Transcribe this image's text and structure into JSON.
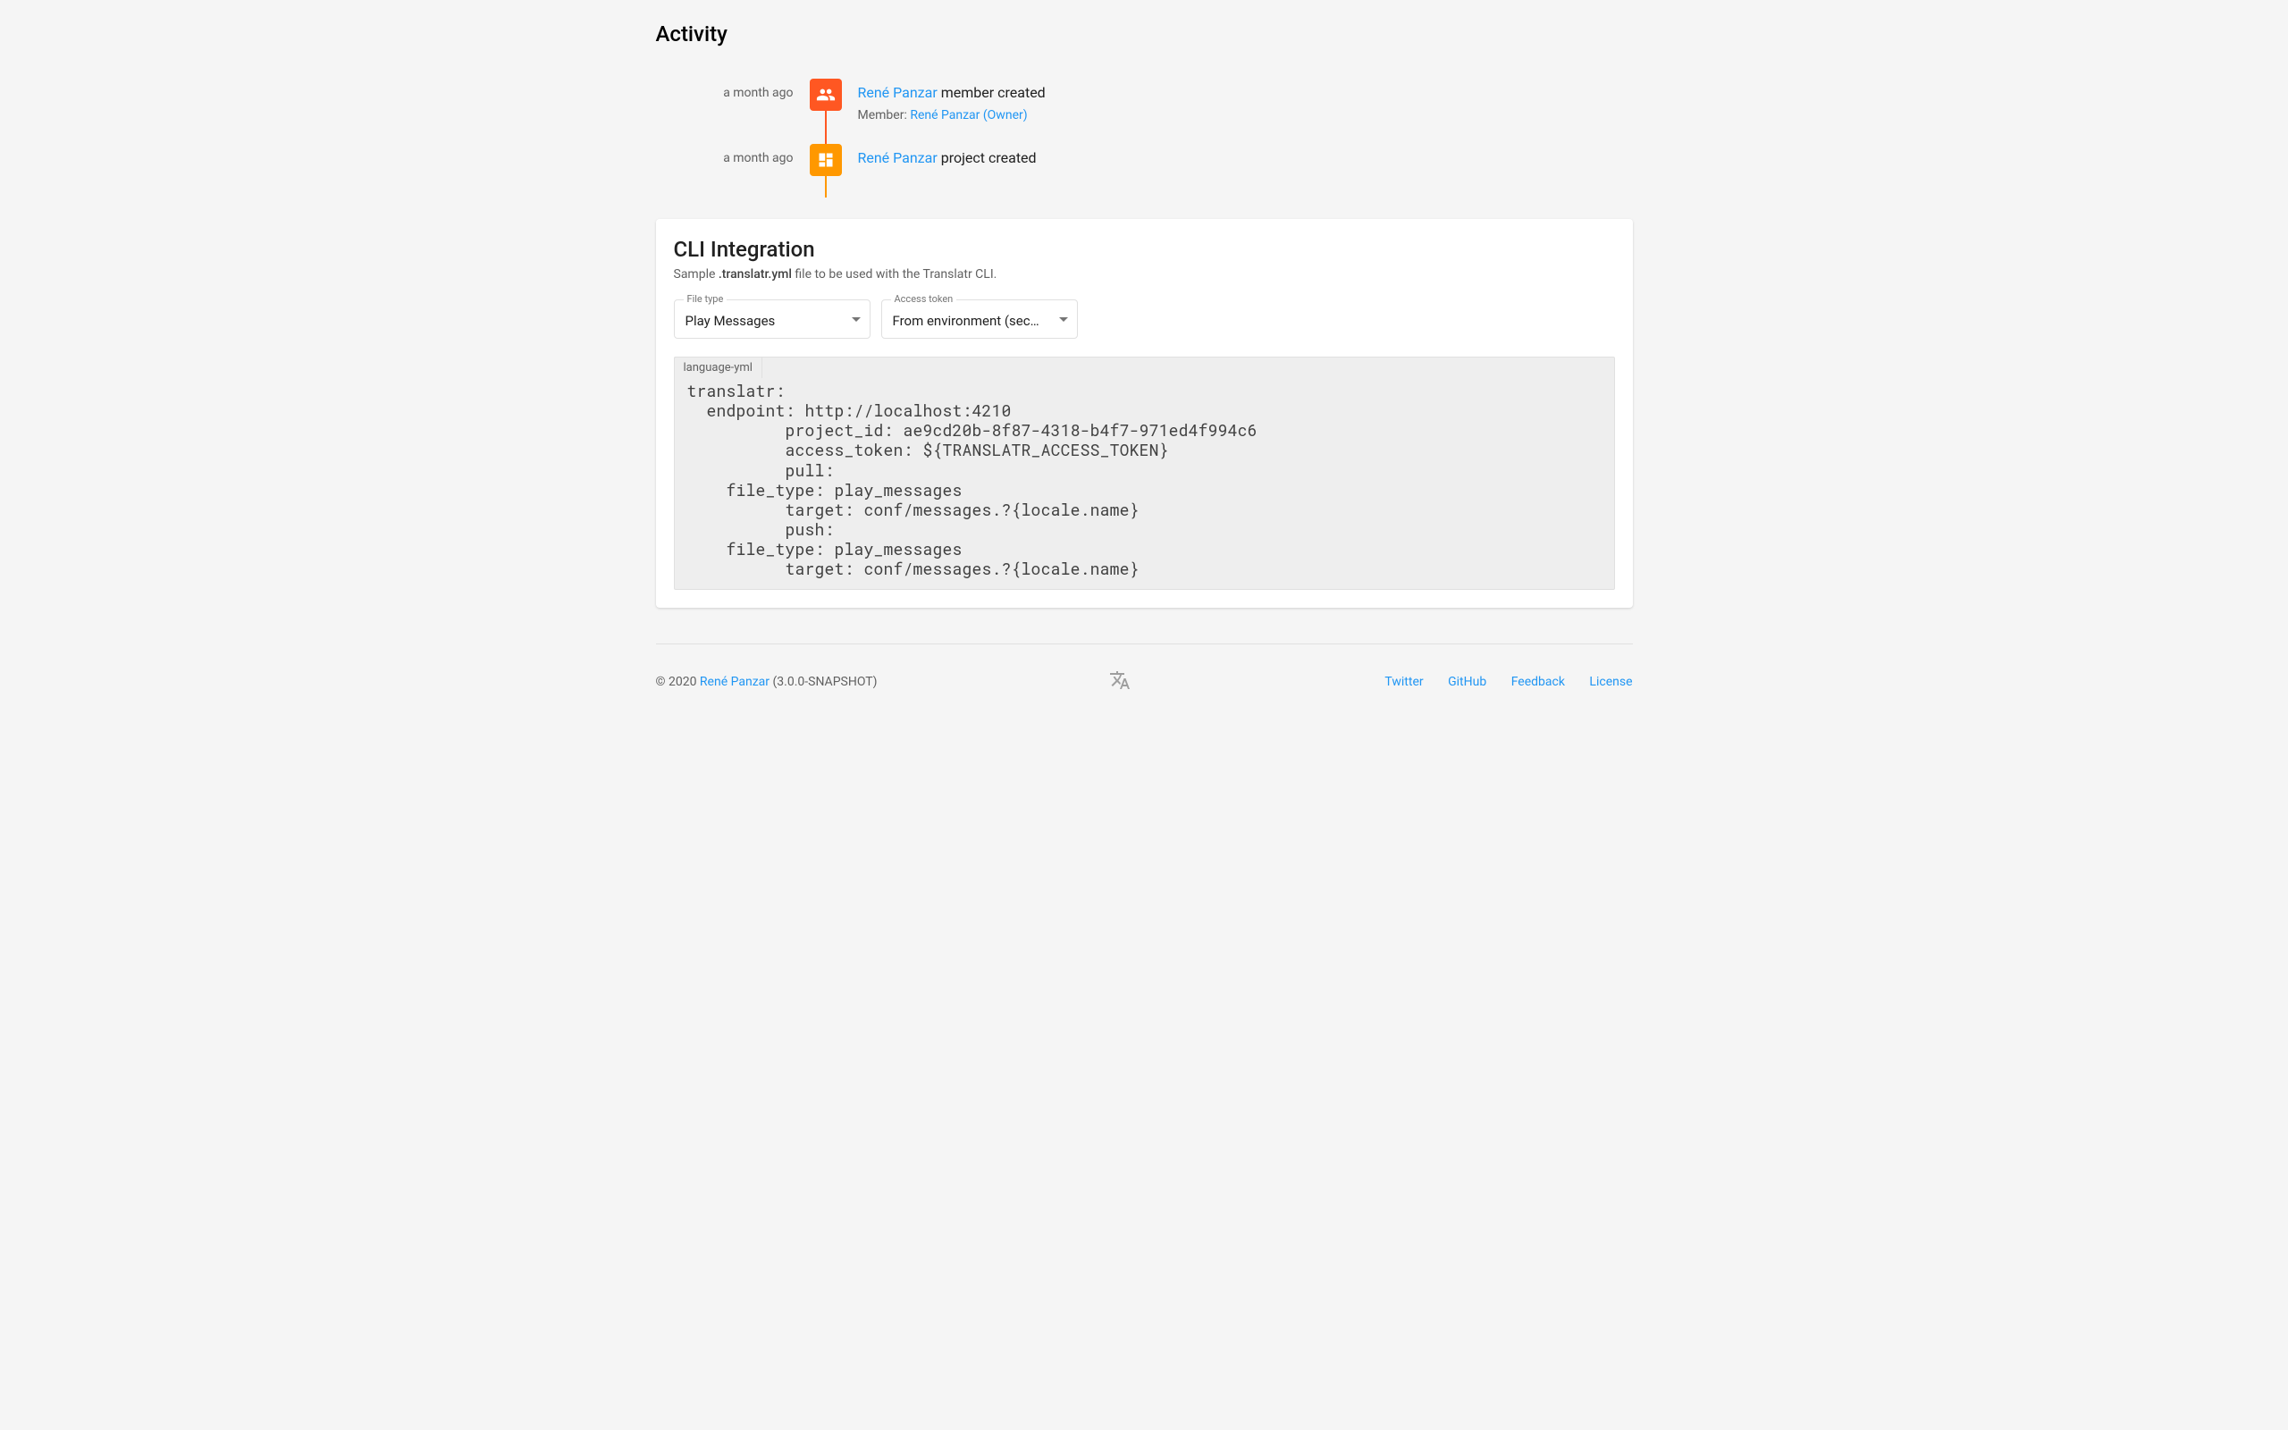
{
  "activity": {
    "heading": "Activity",
    "items": [
      {
        "time": "a month ago",
        "icon": "people",
        "iconColor": "orange",
        "user": "René Panzar",
        "action": " member created",
        "detailLabel": "Member: ",
        "detailLink": "René Panzar (Owner)"
      },
      {
        "time": "a month ago",
        "icon": "dashboard",
        "iconColor": "amber",
        "user": "René Panzar",
        "action": " project created"
      }
    ]
  },
  "cli": {
    "heading": "CLI Integration",
    "sub_pre": "Sample ",
    "sub_strong": ".translatr.yml",
    "sub_post": " file to be used with the Translatr CLI.",
    "fileType": {
      "label": "File type",
      "value": "Play Messages"
    },
    "accessToken": {
      "label": "Access token",
      "value": "From environment (secu…"
    },
    "langTab": "language-yml",
    "code": "translatr:\n  endpoint: http://localhost:4210\n          project_id: ae9cd20b-8f87-4318-b4f7-971ed4f994c6\n          access_token: ${TRANSLATR_ACCESS_TOKEN}\n          pull:\n    file_type: play_messages\n          target: conf/messages.?{locale.name}\n          push:\n    file_type: play_messages\n          target: conf/messages.?{locale.name}"
  },
  "footer": {
    "copyright_pre": "© 2020 ",
    "owner": "René Panzar",
    "version": " (3.0.0-SNAPSHOT)",
    "links": {
      "twitter": "Twitter",
      "github": "GitHub",
      "feedback": "Feedback",
      "license": "License"
    }
  }
}
